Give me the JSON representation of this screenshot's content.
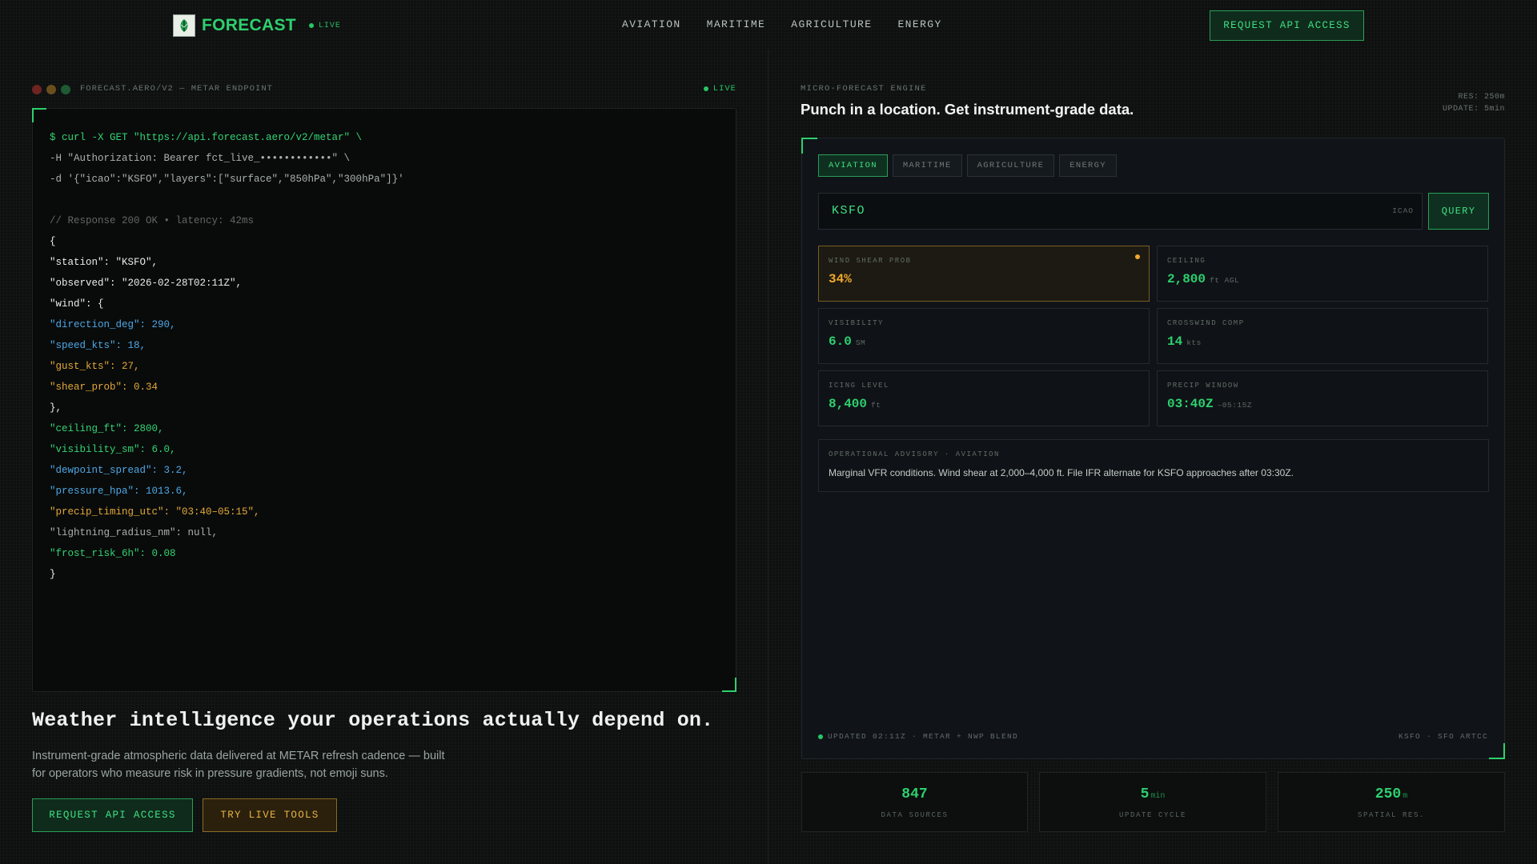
{
  "colors": {
    "accent_green": "#2ed06e",
    "accent_amber": "#f0a92b",
    "background": "#0d100f",
    "panel": "#101419"
  },
  "header": {
    "brand": "FORECAST",
    "live_label": "LIVE",
    "nav": [
      "AVIATION",
      "MARITIME",
      "AGRICULTURE",
      "ENERGY"
    ],
    "cta": "REQUEST API ACCESS"
  },
  "terminal": {
    "title": "FORECAST.AERO/V2 — METAR ENDPOINT",
    "live_label": "LIVE",
    "lines": [
      {
        "text": "$ curl -X GET \"https://api.forecast.aero/v2/metar\" \\",
        "style": "green"
      },
      {
        "text": "-H \"Authorization: Bearer fct_live_••••••••••••\" \\",
        "style": "grey"
      },
      {
        "text": "-d '{\"icao\":\"KSFO\",\"layers\":[\"surface\",\"850hPa\",\"300hPa\"]}'",
        "style": "grey"
      },
      {
        "text": "",
        "style": "grey"
      },
      {
        "text": "// Response 200 OK • latency: 42ms",
        "style": "comment"
      },
      {
        "text": "{",
        "style": "white"
      },
      {
        "text": "\"station\": \"KSFO\",",
        "style": "white"
      },
      {
        "text": "\"observed\": \"2026-02-28T02:11Z\",",
        "style": "white"
      },
      {
        "text": "\"wind\": {",
        "style": "white"
      },
      {
        "text": "\"direction_deg\": 290,",
        "style": "blue"
      },
      {
        "text": "\"speed_kts\": 18,",
        "style": "blue"
      },
      {
        "text": "\"gust_kts\": 27,",
        "style": "amber"
      },
      {
        "text": "\"shear_prob\": 0.34",
        "style": "amber"
      },
      {
        "text": "},",
        "style": "white"
      },
      {
        "text": "\"ceiling_ft\": 2800,",
        "style": "green"
      },
      {
        "text": "\"visibility_sm\": 6.0,",
        "style": "green"
      },
      {
        "text": "\"dewpoint_spread\": 3.2,",
        "style": "blue"
      },
      {
        "text": "\"pressure_hpa\": 1013.6,",
        "style": "blue"
      },
      {
        "text": "\"precip_timing_utc\": \"03:40–05:15\",",
        "style": "amber"
      },
      {
        "text": "\"lightning_radius_nm\": null,",
        "style": "grey"
      },
      {
        "text": "\"frost_risk_6h\": 0.08",
        "style": "green"
      },
      {
        "text": "}",
        "style": "white"
      }
    ]
  },
  "hero": {
    "title": "Weather intelligence your operations actually depend on.",
    "subtitle": "Instrument-grade atmospheric data delivered at METAR refresh cadence — built for operators who measure risk in pressure gradients, not emoji suns.",
    "primary_cta": "REQUEST API ACCESS",
    "secondary_cta": "TRY LIVE TOOLS"
  },
  "engine": {
    "eyebrow": "MICRO-FORECAST ENGINE",
    "title": "Punch in a location. Get instrument-grade data.",
    "meta_res": "RES: 250m",
    "meta_update": "UPDATE: 5min",
    "tabs": [
      "AVIATION",
      "MARITIME",
      "AGRICULTURE",
      "ENERGY"
    ],
    "search_value": "KSFO",
    "search_tag": "ICAO",
    "query_label": "QUERY",
    "metrics": [
      {
        "label": "WIND SHEAR PROB",
        "value": "34%",
        "unit": "",
        "warn": true
      },
      {
        "label": "CEILING",
        "value": "2,800",
        "unit": "ft AGL",
        "warn": false
      },
      {
        "label": "VISIBILITY",
        "value": "6.0",
        "unit": "SM",
        "warn": false
      },
      {
        "label": "CROSSWIND COMP",
        "value": "14",
        "unit": "kts",
        "warn": false
      },
      {
        "label": "ICING LEVEL",
        "value": "8,400",
        "unit": "ft",
        "warn": false
      },
      {
        "label": "PRECIP WINDOW",
        "value": "03:40Z",
        "unit": "–05:15Z",
        "warn": false
      }
    ],
    "advisory_label": "OPERATIONAL ADVISORY · AVIATION",
    "advisory_text": "Marginal VFR conditions. Wind shear at 2,000–4,000 ft. File IFR alternate for KSFO approaches after 03:30Z.",
    "footer_left": "UPDATED 02:11Z · METAR + NWP BLEND",
    "footer_right": "KSFO · SFO ARTCC"
  },
  "stats": [
    {
      "value": "847",
      "unit": "",
      "label": "DATA SOURCES"
    },
    {
      "value": "5",
      "unit": "min",
      "label": "UPDATE CYCLE"
    },
    {
      "value": "250",
      "unit": "m",
      "label": "SPATIAL RES."
    }
  ]
}
